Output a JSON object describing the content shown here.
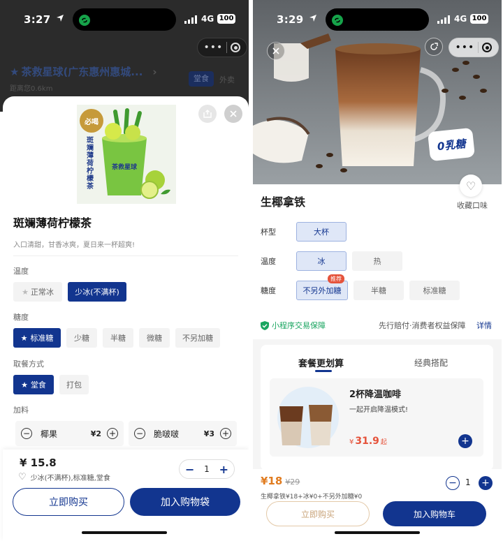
{
  "colors": {
    "brand": "#12358f",
    "price_orange": "#e07b1f",
    "guarantee_green": "#1aa560"
  },
  "left": {
    "status": {
      "time": "3:27",
      "network": "4G",
      "battery": "100"
    },
    "store": {
      "name": "茶救星球(广东惠州惠城...",
      "distance": "距离您0.6km",
      "tabs": [
        "堂食",
        "外卖"
      ]
    },
    "product": {
      "name": "斑斓薄荷柠檬茶",
      "desc": "入口清甜，甘香冰爽，夏日来一杯超爽!",
      "image_badge": "必喝",
      "image_text": "斑斓薄荷柠檬茶",
      "image_brand": "茶救星球"
    },
    "temperature": {
      "label": "温度",
      "options": [
        "正常冰",
        "少冰(不满杯)"
      ],
      "selected": 1
    },
    "sugar": {
      "label": "糖度",
      "options": [
        "标准糖",
        "少糖",
        "半糖",
        "微糖",
        "不另加糖"
      ],
      "selected": 0
    },
    "pickup": {
      "label": "取餐方式",
      "options": [
        "堂食",
        "打包"
      ],
      "selected": 0
    },
    "toppings": {
      "label": "加料",
      "items": [
        {
          "name": "椰果",
          "price": "¥2"
        },
        {
          "name": "脆啵啵",
          "price": "¥3"
        }
      ]
    },
    "footer": {
      "price": "¥ 15.8",
      "summary": "少冰(不满杯),标准糖,堂食",
      "quantity": "1",
      "buy_now": "立即购买",
      "add_to_bag": "加入购物袋"
    }
  },
  "right": {
    "status": {
      "time": "3:29",
      "network": "4G",
      "battery": "100"
    },
    "hero": {
      "badge": "0乳糖"
    },
    "product": {
      "name": "生椰拿铁",
      "favorite": "收藏口味"
    },
    "cup": {
      "label": "杯型",
      "options": [
        "大杯"
      ],
      "selected": 0
    },
    "temperature": {
      "label": "温度",
      "options": [
        "冰",
        "热"
      ],
      "selected": 0
    },
    "sugar": {
      "label": "糖度",
      "options": [
        "不另外加糖",
        "半糖",
        "标准糖"
      ],
      "selected": 0,
      "tag": "推荐"
    },
    "guarantee": {
      "left": "小程序交易保障",
      "right": "先行赔付·消费者权益保障",
      "link": "详情"
    },
    "combo": {
      "tabs": [
        "套餐更划算",
        "经典搭配"
      ],
      "selected": 0,
      "card": {
        "title": "2杯降温咖啡",
        "subtitle": "一起开启降温模式!",
        "price_symbol": "¥",
        "price": "31.9",
        "price_suffix": "起"
      }
    },
    "footer": {
      "price": "¥18",
      "original": "¥29",
      "detail": "生椰拿铁¥18+冰¥0+不另外加糖¥0",
      "quantity": "1",
      "buy_now": "立即购买",
      "add_to_cart": "加入购物车"
    }
  }
}
